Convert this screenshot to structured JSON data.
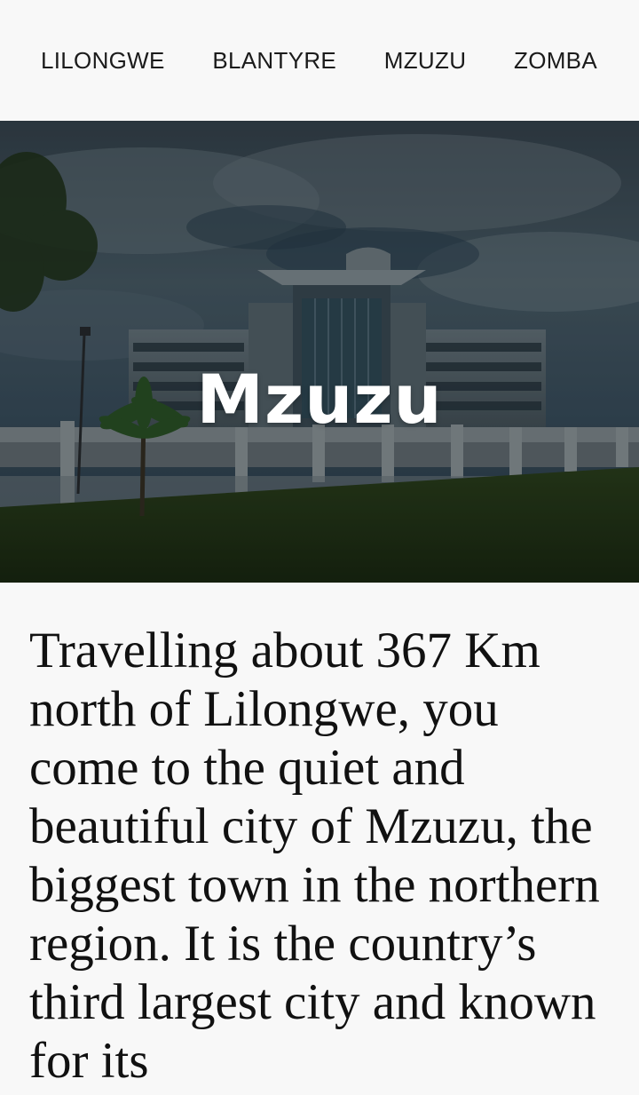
{
  "nav": {
    "items": [
      {
        "label": "LILONGWE"
      },
      {
        "label": "BLANTYRE"
      },
      {
        "label": "MZUZU"
      },
      {
        "label": "ZOMBA"
      }
    ]
  },
  "hero": {
    "title": "Mzuzu"
  },
  "article": {
    "paragraph": "Travelling about 367 Km north of Lilongwe, you come to the quiet and beautiful city of Mzuzu, the biggest town in the northern region. It is the country’s third largest city and known for its"
  },
  "colors": {
    "background": "#f8f8f8",
    "nav_text": "#1b1b1b",
    "hero_title": "#ffffff",
    "body_text": "#111111"
  }
}
